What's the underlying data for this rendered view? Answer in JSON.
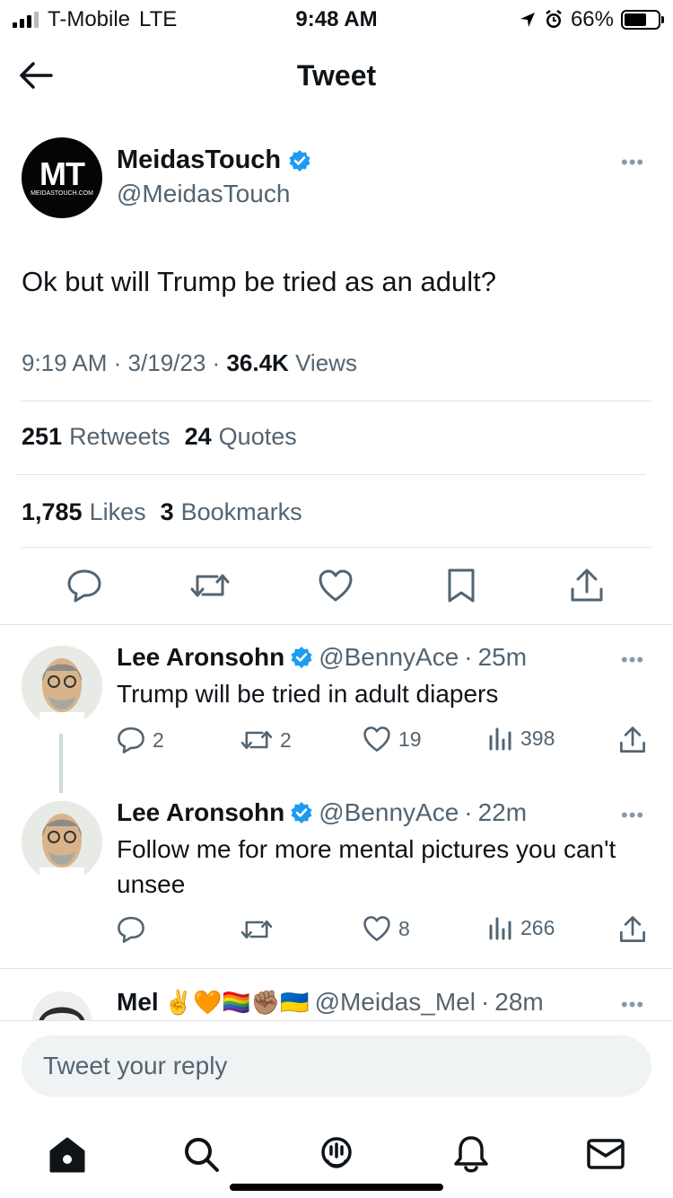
{
  "status_bar": {
    "carrier": "T-Mobile",
    "network": "LTE",
    "time": "9:48 AM",
    "battery": "66%",
    "battery_level": 0.66,
    "signal_bars": 3
  },
  "header": {
    "title": "Tweet"
  },
  "tweet": {
    "author_name": "MeidasTouch",
    "author_handle": "@MeidasTouch",
    "avatar_text": "MT",
    "avatar_subtext": "MEIDASTOUCH.COM",
    "text": "Ok but will Trump be tried as an adult?",
    "time": "9:19 AM",
    "date": "3/19/23",
    "views_count": "36.4K",
    "views_label": "Views",
    "retweets_count": "251",
    "retweets_label": "Retweets",
    "quotes_count": "24",
    "quotes_label": "Quotes",
    "likes_count": "1,785",
    "likes_label": "Likes",
    "bookmarks_count": "3",
    "bookmarks_label": "Bookmarks",
    "more": "•••"
  },
  "replies": [
    {
      "name": "Lee Aronsohn",
      "handle": "@BennyAce",
      "age": "25m",
      "text": "Trump will be tried in adult diapers",
      "replies": "2",
      "retweets": "2",
      "likes": "19",
      "views": "398"
    },
    {
      "name": "Lee Aronsohn",
      "handle": "@BennyAce",
      "age": "22m",
      "text": "Follow me for more mental pictures you can't unsee",
      "replies": "",
      "retweets": "",
      "likes": "8",
      "views": "266"
    }
  ],
  "partial_reply": {
    "name": "Mel",
    "emojis": "✌️🧡🏳️‍🌈✊🏽🇺🇦",
    "handle": "@Meidas_Mel",
    "age": "28m"
  },
  "separator": "·",
  "reply_bar": {
    "placeholder": "Tweet your reply"
  },
  "colors": {
    "verified": "#1d9bf0",
    "text": "#0f1419",
    "secondary": "#536471",
    "divider": "#e1e6ea"
  }
}
